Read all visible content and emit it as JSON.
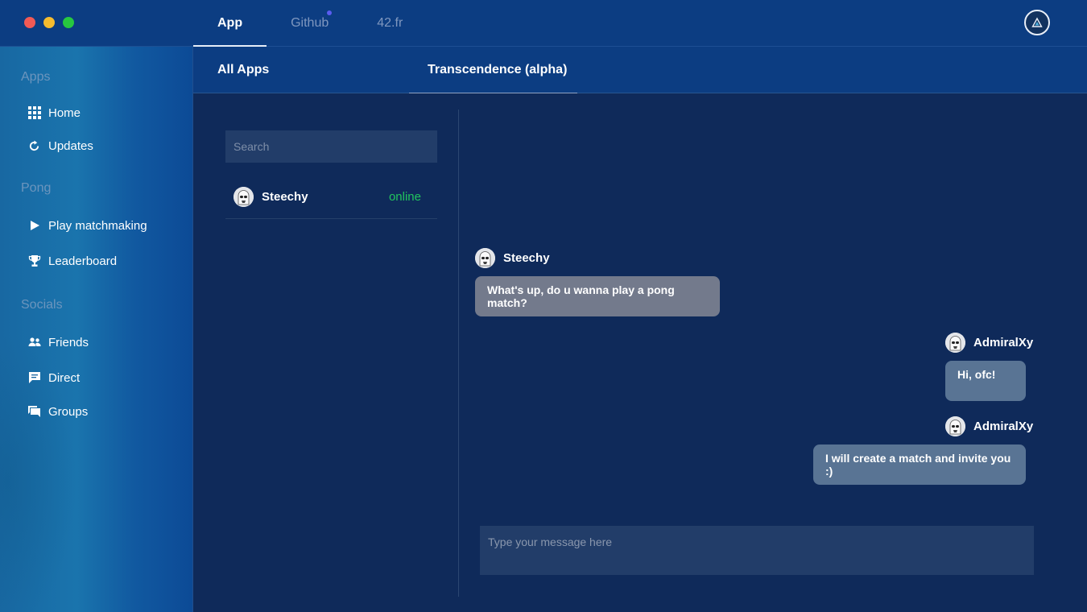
{
  "top_tabs": [
    {
      "label": "App",
      "active": true
    },
    {
      "label": "Github",
      "active": false,
      "notification": true
    },
    {
      "label": "42.fr",
      "active": false
    }
  ],
  "sidebar": {
    "sections": [
      {
        "title": "Apps",
        "items": [
          {
            "label": "Home",
            "icon": "grid-icon"
          },
          {
            "label": "Updates",
            "icon": "refresh-icon"
          }
        ]
      },
      {
        "title": "Pong",
        "items": [
          {
            "label": "Play matchmaking",
            "icon": "play-icon"
          },
          {
            "label": "Leaderboard",
            "icon": "trophy-icon"
          }
        ]
      },
      {
        "title": "Socials",
        "items": [
          {
            "label": "Friends",
            "icon": "friends-icon"
          },
          {
            "label": "Direct",
            "icon": "chat-icon"
          },
          {
            "label": "Groups",
            "icon": "groups-icon"
          }
        ]
      }
    ]
  },
  "sub_tabs": [
    {
      "label": "All Apps",
      "active": false
    },
    {
      "label": "Transcendence (alpha)",
      "active": true
    }
  ],
  "search": {
    "placeholder": "Search",
    "value": ""
  },
  "contacts": [
    {
      "name": "Steechy",
      "status": "online",
      "status_color": "#22c55e"
    }
  ],
  "messages": [
    {
      "author": "Steechy",
      "text": "What's up, do u wanna play a pong match?",
      "direction": "in"
    },
    {
      "author": "AdmiralXy",
      "text": "Hi, ofc!",
      "direction": "out"
    },
    {
      "author": "AdmiralXy",
      "text": "I will create a match and invite you :)",
      "direction": "out"
    }
  ],
  "composer": {
    "placeholder": "Type your message here",
    "value": ""
  },
  "colors": {
    "topbar": "#0c3d82",
    "main_bg": "#0f2a5a",
    "incoming_bubble": "#737a8c",
    "outgoing_bubble": "#597494",
    "online": "#22c55e"
  }
}
